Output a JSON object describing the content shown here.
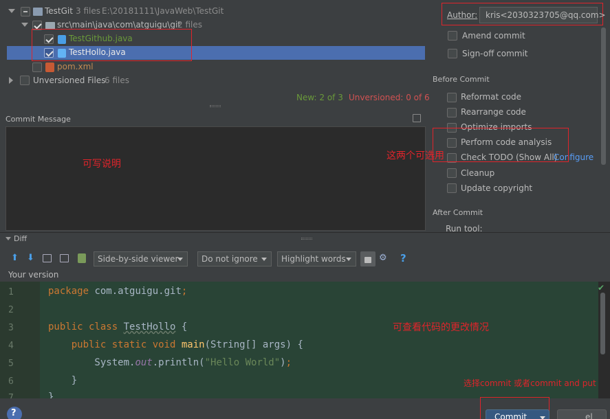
{
  "file_tree": {
    "root": {
      "label": "TestGit",
      "count": "3 files",
      "path": "E:\\20181111\\JavaWeb\\TestGit"
    },
    "package": {
      "label": "src\\main\\java\\com\\atguigu\\git",
      "count": "2 files"
    },
    "files": [
      "TestGithub.java",
      "TestHollo.java",
      "pom.xml"
    ],
    "unversioned": {
      "label": "Unversioned Files",
      "count": "6 files"
    }
  },
  "status": {
    "new": "New: 2 of 3",
    "unversioned": "Unversioned: 0 of 6"
  },
  "commit_message": {
    "label": "Commit Message",
    "annotation": "可写说明"
  },
  "right_panel": {
    "author_label": "Author:",
    "author_value": "kris<2030323705@qq.com>",
    "amend": "Amend commit",
    "signoff": "Sign-off commit",
    "before_commit": "Before Commit",
    "options": [
      "Reformat code",
      "Rearrange code",
      "Optimize imports",
      "Perform code analysis",
      "Check TODO (Show All)",
      "Cleanup",
      "Update copyright"
    ],
    "configure": "Configure",
    "after_commit": "After Commit",
    "run_tool": "Run tool:",
    "annotation": "这两个可选用"
  },
  "diff": {
    "title": "Diff",
    "viewer": "Side-by-side viewer",
    "ignore": "Do not ignore",
    "highlight": "Highlight words",
    "help": "?",
    "your_version": "Your version",
    "line_numbers": [
      "1",
      "2",
      "3",
      "4",
      "5",
      "6",
      "7"
    ],
    "annotation": "可查看代码的更改情况",
    "commit_annotation": "选择commit 或者commit and put"
  },
  "bottom": {
    "help": "?",
    "commit_button": "Commit",
    "cancel_partial": "el"
  },
  "colors": {
    "accent": "#4b6eaf",
    "red": "#e0242b",
    "green_bg": "#294436",
    "new_green": "#6a9a3a",
    "unversioned_red": "#d25252"
  }
}
